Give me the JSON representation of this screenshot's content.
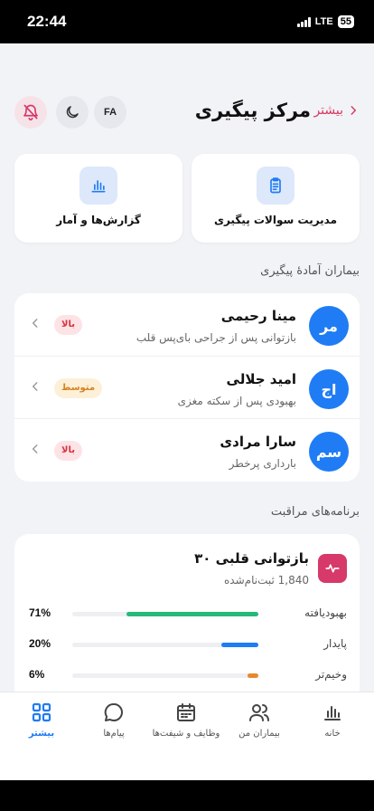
{
  "status_bar": {
    "time": "22:44",
    "network": "LTE",
    "battery": "55"
  },
  "header": {
    "title": "مرکز پیگیری",
    "back_label": "بیشتر",
    "lang_label": "FA"
  },
  "actions": [
    {
      "label": "مدیریت سوالات پیگیری",
      "icon": "clipboard-icon"
    },
    {
      "label": "گزارش‌ها و آمار",
      "icon": "bar-chart-icon"
    }
  ],
  "patients_section": {
    "title": "بیماران آمادهٔ پیگیری",
    "patients": [
      {
        "initials": "مر",
        "name": "مینا رحیمی",
        "desc": "بازتوانی پس از جراحی بای‌پس قلب",
        "priority": "بالا",
        "level": "high"
      },
      {
        "initials": "اج",
        "name": "امید جلالی",
        "desc": "بهبودی پس از سکته مغزی",
        "priority": "متوسط",
        "level": "mid"
      },
      {
        "initials": "سم",
        "name": "سارا مرادی",
        "desc": "بارداری پرخطر",
        "priority": "بالا",
        "level": "high"
      }
    ]
  },
  "care_section": {
    "title": "برنامه‌های مراقبت",
    "program": {
      "title": "بازتوانی قلبی ۳۰",
      "subtitle": "1,840 ثبت‌نام‌شده",
      "stats": [
        {
          "label": "بهبودیافته",
          "percent_text": "71%",
          "value": 0.71,
          "color": "#27b87a"
        },
        {
          "label": "پایدار",
          "percent_text": "20%",
          "value": 0.2,
          "color": "#1f7cf5"
        },
        {
          "label": "وخیم‌تر",
          "percent_text": "6%",
          "value": 0.06,
          "color": "#e6892b"
        }
      ]
    }
  },
  "tabbar": {
    "tabs": [
      {
        "label": "خانه",
        "icon": "bar-chart-icon",
        "active": false
      },
      {
        "label": "بیماران من",
        "icon": "users-icon",
        "active": false
      },
      {
        "label": "وظایف و شیفت‌ها",
        "icon": "calendar-icon",
        "active": false
      },
      {
        "label": "پیام‌ها",
        "icon": "chat-bubble-icon",
        "active": false
      },
      {
        "label": "بیشتر",
        "icon": "grid-icon",
        "active": true
      }
    ]
  },
  "colors": {
    "accent": "#1f7cf5",
    "brand_pink": "#d6396a",
    "background": "#f2f3f7"
  }
}
